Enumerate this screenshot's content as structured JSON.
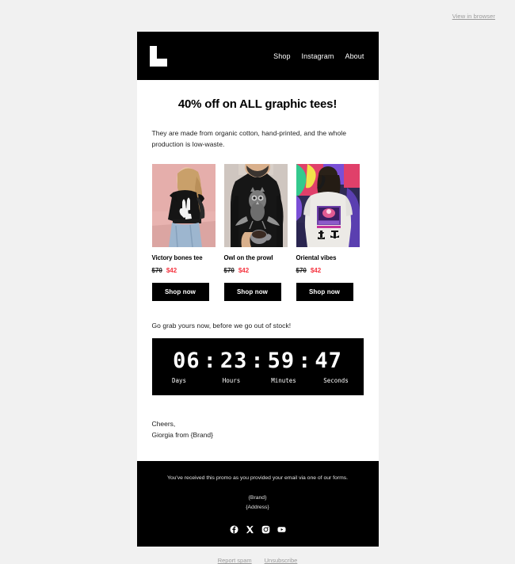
{
  "preheader": {
    "view_in_browser": "View in browser"
  },
  "header": {
    "logo_name": "L",
    "nav": [
      {
        "label": "Shop"
      },
      {
        "label": "Instagram"
      },
      {
        "label": "About"
      }
    ]
  },
  "main": {
    "headline": "40% off on ALL graphic tees!",
    "intro": "They are made from organic cotton, hand-printed, and the whole production is low-waste.",
    "urgency": "Go grab yours now, before we go out of stock!",
    "products": [
      {
        "name": "Victory bones tee",
        "old_price": "$70",
        "new_price": "$42",
        "cta": "Shop now",
        "image_alt": "woman-in-black-peace-sign-tee"
      },
      {
        "name": "Owl on the prowl",
        "old_price": "$70",
        "new_price": "$42",
        "cta": "Shop now",
        "image_alt": "man-in-black-owl-tee-with-mug"
      },
      {
        "name": "Oriental vibes",
        "old_price": "$70",
        "new_price": "$42",
        "cta": "Shop now",
        "image_alt": "person-in-white-anime-graphic-tee"
      }
    ],
    "countdown": {
      "days": "06",
      "hours": "23",
      "minutes": "59",
      "seconds": "47",
      "separator": ":",
      "labels": {
        "days": "Days",
        "hours": "Hours",
        "minutes": "Minutes",
        "seconds": "Seconds"
      }
    },
    "signoff_line1": "Cheers,",
    "signoff_line2": "Giorgia from {Brand}"
  },
  "footer": {
    "disclaimer": "You've received this promo as you provided your email via one of our forms.",
    "brand": "{Brand}",
    "address": "{Address}",
    "socials": [
      {
        "name": "facebook-icon"
      },
      {
        "name": "x-twitter-icon"
      },
      {
        "name": "instagram-icon"
      },
      {
        "name": "youtube-icon"
      }
    ]
  },
  "bottom_links": [
    {
      "label": "Report spam"
    },
    {
      "label": "Unsubscribe"
    }
  ],
  "colors": {
    "page_background": "#f1f1f1",
    "email_background": "#ffffff",
    "brand_black": "#000000",
    "sale_red": "#f5333f",
    "muted_link": "#9a9a9a"
  }
}
